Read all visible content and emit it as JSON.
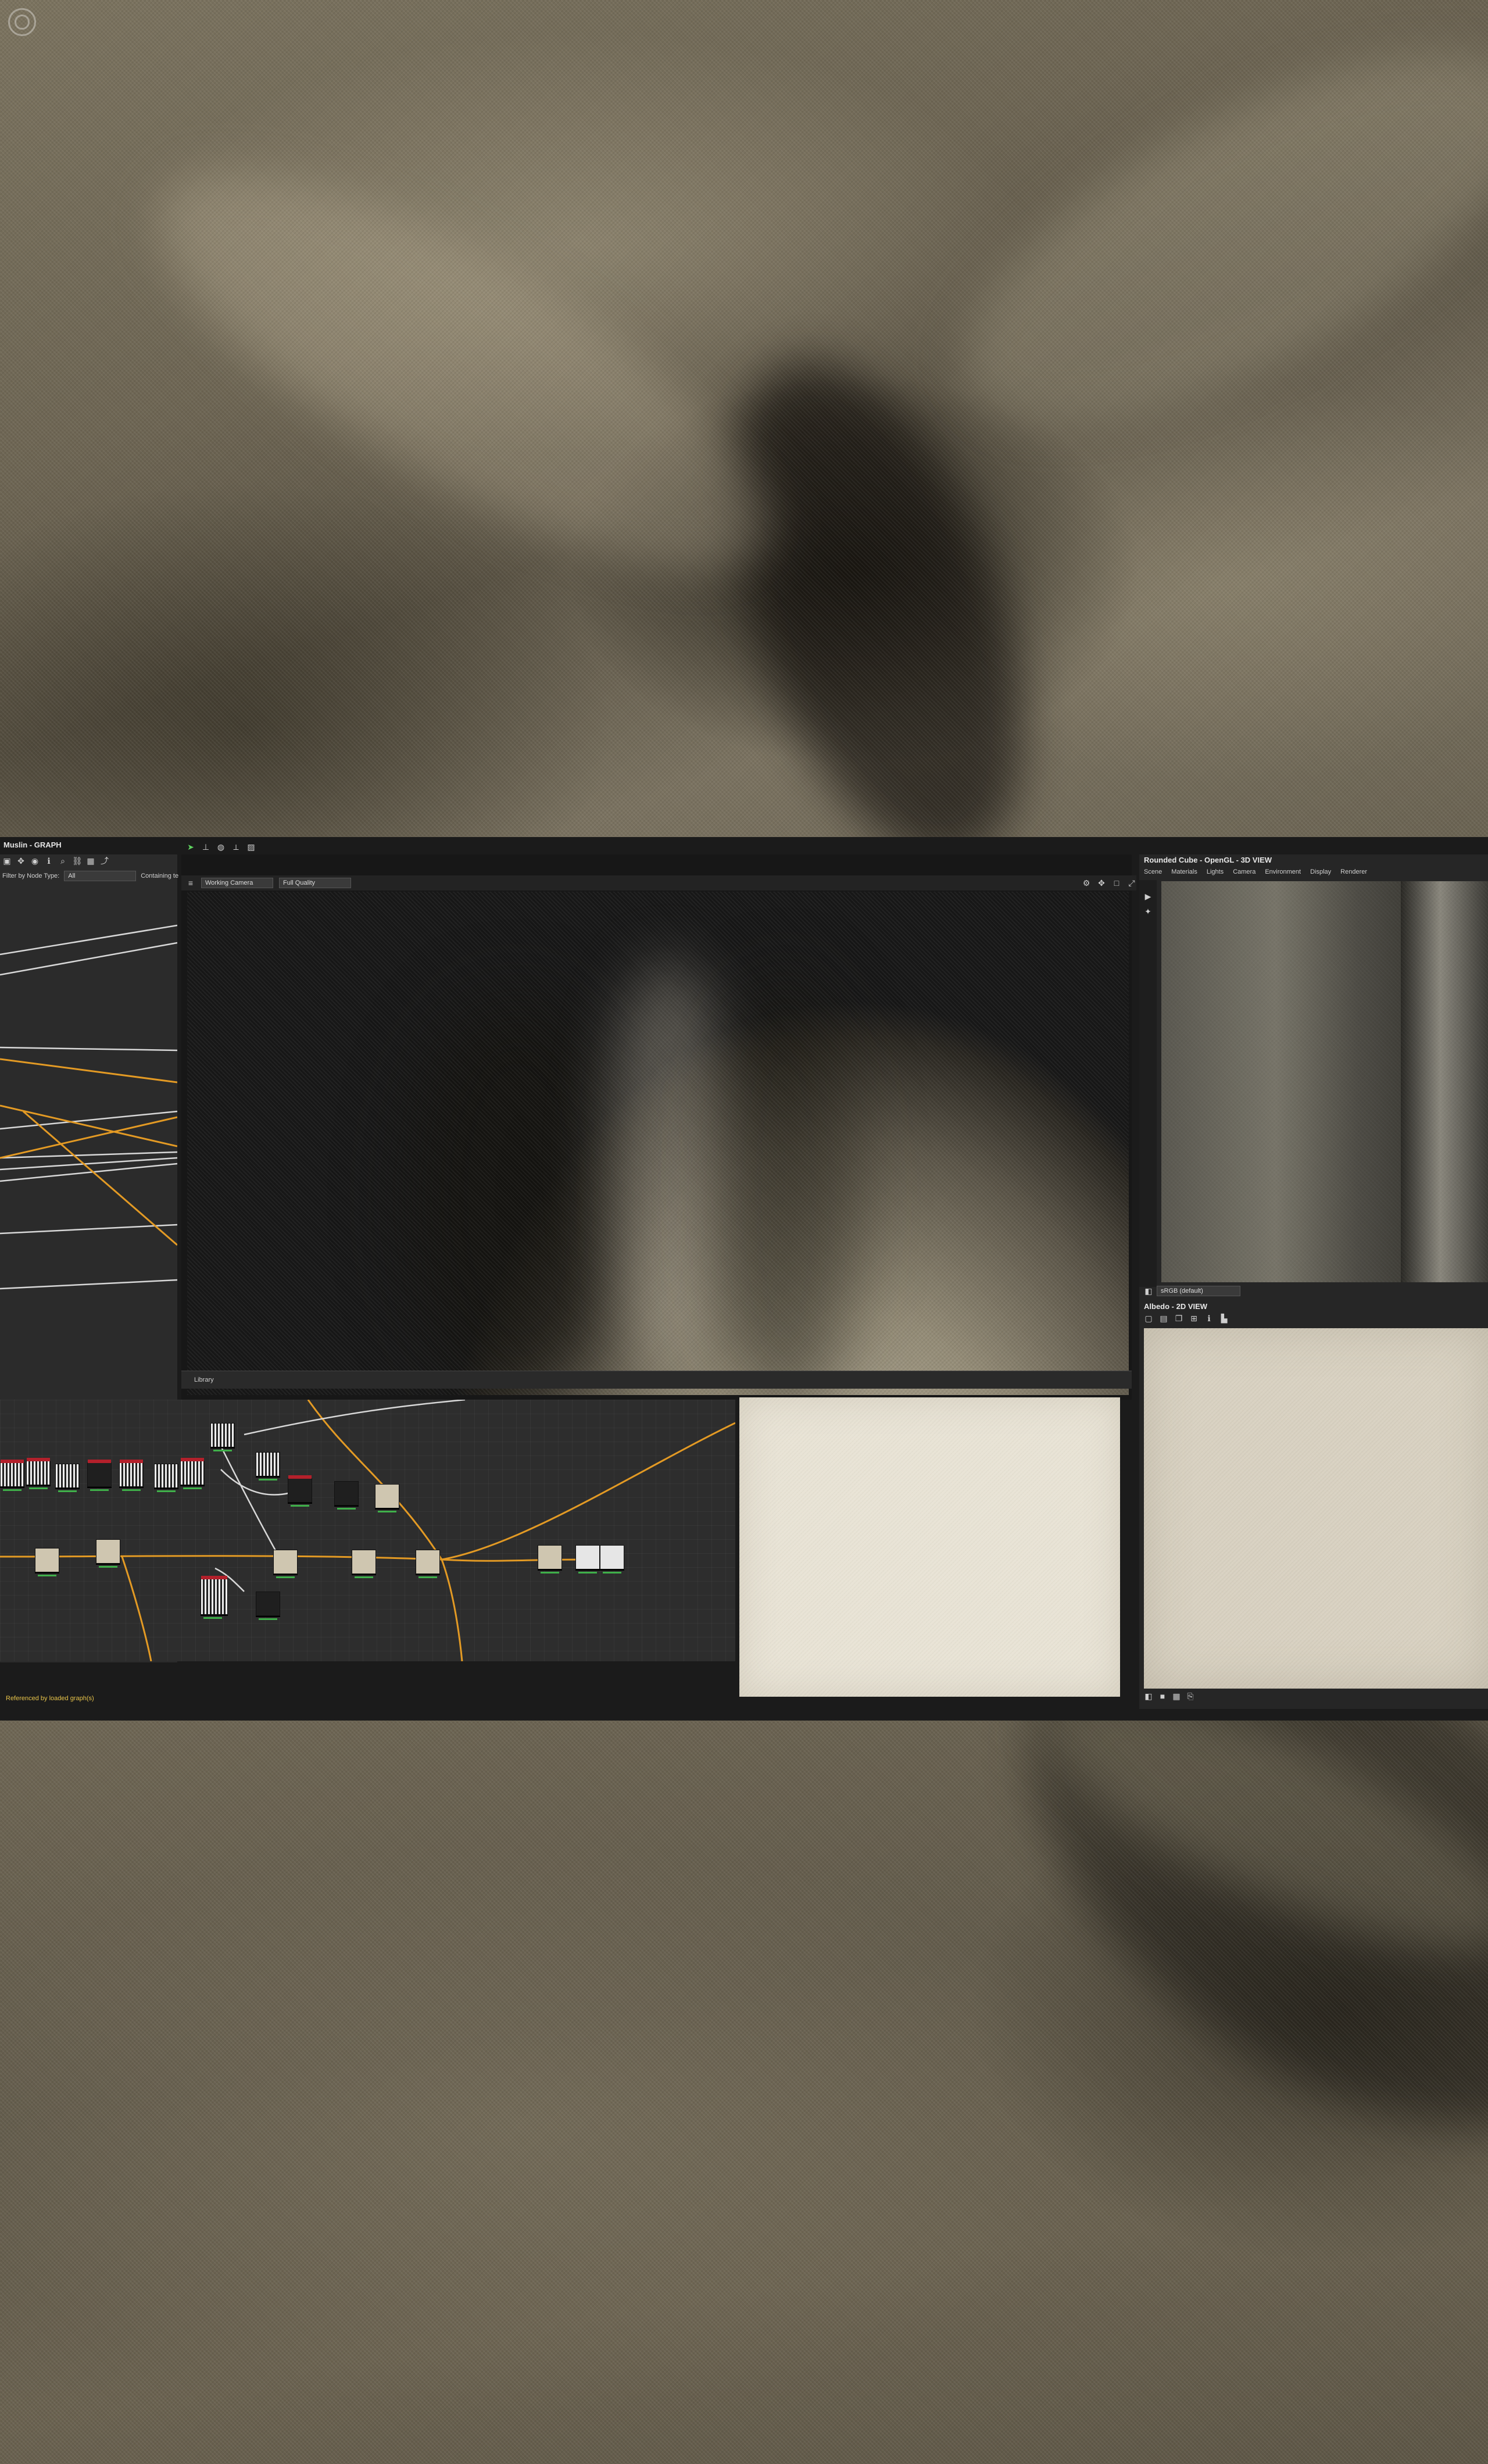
{
  "graph_panel": {
    "title": "Muslin - GRAPH",
    "filter_label": "Filter by Node Type:",
    "filter_value": "All",
    "containing_label": "Containing te"
  },
  "viewport": {
    "camera_value": "Working Camera",
    "quality_value": "Full Quality",
    "library_label": "Library"
  },
  "right_panel": {
    "view3d_title": "Rounded Cube - OpenGL - 3D VIEW",
    "menu": [
      "Scene",
      "Materials",
      "Lights",
      "Camera",
      "Environment",
      "Display",
      "Renderer"
    ],
    "colorspace": "sRGB (default)",
    "view2d_title": "Albedo - 2D VIEW"
  },
  "status": {
    "message": "Referenced by loaded graph(s)"
  }
}
